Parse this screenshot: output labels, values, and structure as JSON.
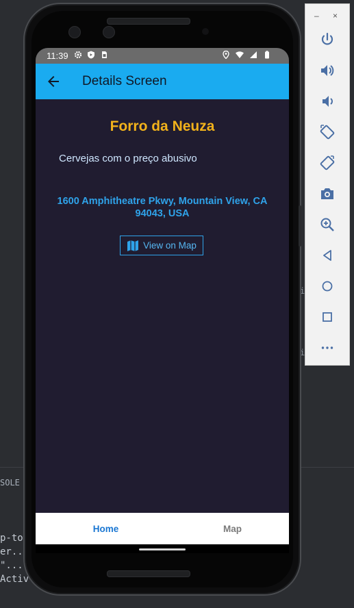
{
  "ide": {
    "console_label": "SOLE",
    "code_lines": [
      "p-to",
      "er..",
      "\"...",
      "Activ"
    ],
    "side_letters": [
      "i",
      "i"
    ]
  },
  "statusbar": {
    "time": "11:39",
    "icons_left": [
      "gear-icon",
      "shield-icon",
      "sim-icon"
    ],
    "icons_right": [
      "location-icon",
      "wifi-icon",
      "signal-icon",
      "battery-icon"
    ]
  },
  "appbar": {
    "title": "Details Screen",
    "back_icon": "arrow-back-icon",
    "color": "#1aabf0"
  },
  "details": {
    "title": "Forro da Neuza",
    "title_color": "#f2b21b",
    "description": "Cervejas com o preço abusivo",
    "address_line1": "1600 Amphitheatre Pkwy, Mountain View, CA",
    "address_line2": "94043, USA",
    "map_button_label": "View on Map",
    "map_button_icon": "map-icon"
  },
  "bottom_nav": {
    "items": [
      {
        "label": "Home",
        "active": true
      },
      {
        "label": "Map",
        "active": false
      }
    ],
    "active_color": "#1976d2"
  },
  "emulator_toolbar": {
    "minimize": "–",
    "close": "×",
    "buttons": [
      "power-icon",
      "volume-up-icon",
      "volume-down-icon",
      "rotate-left-icon",
      "rotate-right-icon",
      "camera-icon",
      "zoom-icon",
      "back-icon",
      "home-icon",
      "overview-icon",
      "more-icon"
    ]
  }
}
